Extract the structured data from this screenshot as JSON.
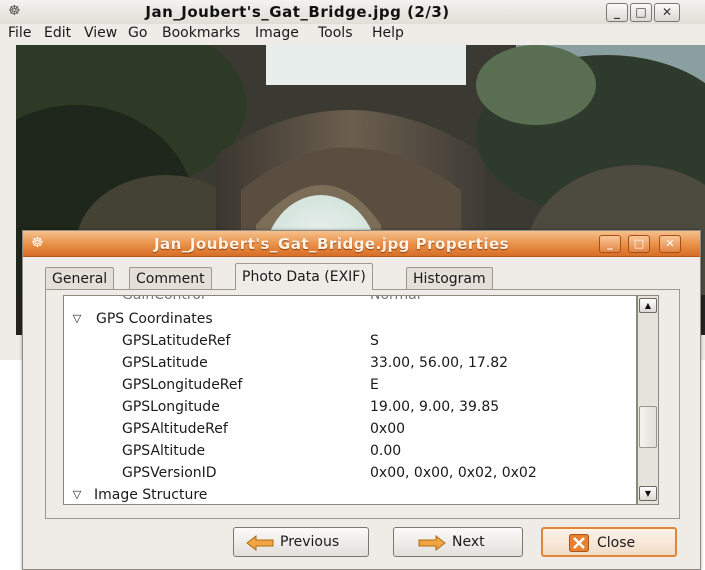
{
  "viewer": {
    "title": "Jan_Joubert's_Gat_Bridge.jpg  (2/3)",
    "menu": [
      "File",
      "Edit",
      "View",
      "Go",
      "Bookmarks",
      "Image",
      "Tools",
      "Help"
    ],
    "window_buttons": [
      "minimize-icon",
      "maximize-icon",
      "close-icon"
    ]
  },
  "dialog": {
    "title": "Jan_Joubert's_Gat_Bridge.jpg Properties",
    "tabs": [
      "General",
      "Comment",
      "Photo Data (EXIF)",
      "Histogram"
    ],
    "active_tab": "Photo Data (EXIF)",
    "partial_row": {
      "key": "GainControl",
      "value": "Normal"
    },
    "groups": [
      {
        "label": "GPS Coordinates",
        "expanded": true,
        "rows": [
          {
            "key": "GPSLatitudeRef",
            "value": "S"
          },
          {
            "key": "GPSLatitude",
            "value": "33.00, 56.00, 17.82"
          },
          {
            "key": "GPSLongitudeRef",
            "value": "E"
          },
          {
            "key": "GPSLongitude",
            "value": "19.00, 9.00, 39.85"
          },
          {
            "key": "GPSAltitudeRef",
            "value": "0x00"
          },
          {
            "key": "GPSAltitude",
            "value": "0.00"
          },
          {
            "key": "GPSVersionID",
            "value": "0x00, 0x00, 0x02, 0x02"
          }
        ]
      },
      {
        "label": "Image Structure",
        "expanded": true,
        "rows": []
      }
    ],
    "buttons": {
      "previous": "Previous",
      "next": "Next",
      "close": "Close"
    }
  },
  "colors": {
    "accent": "#e98f46",
    "window_bg": "#efebe7"
  }
}
